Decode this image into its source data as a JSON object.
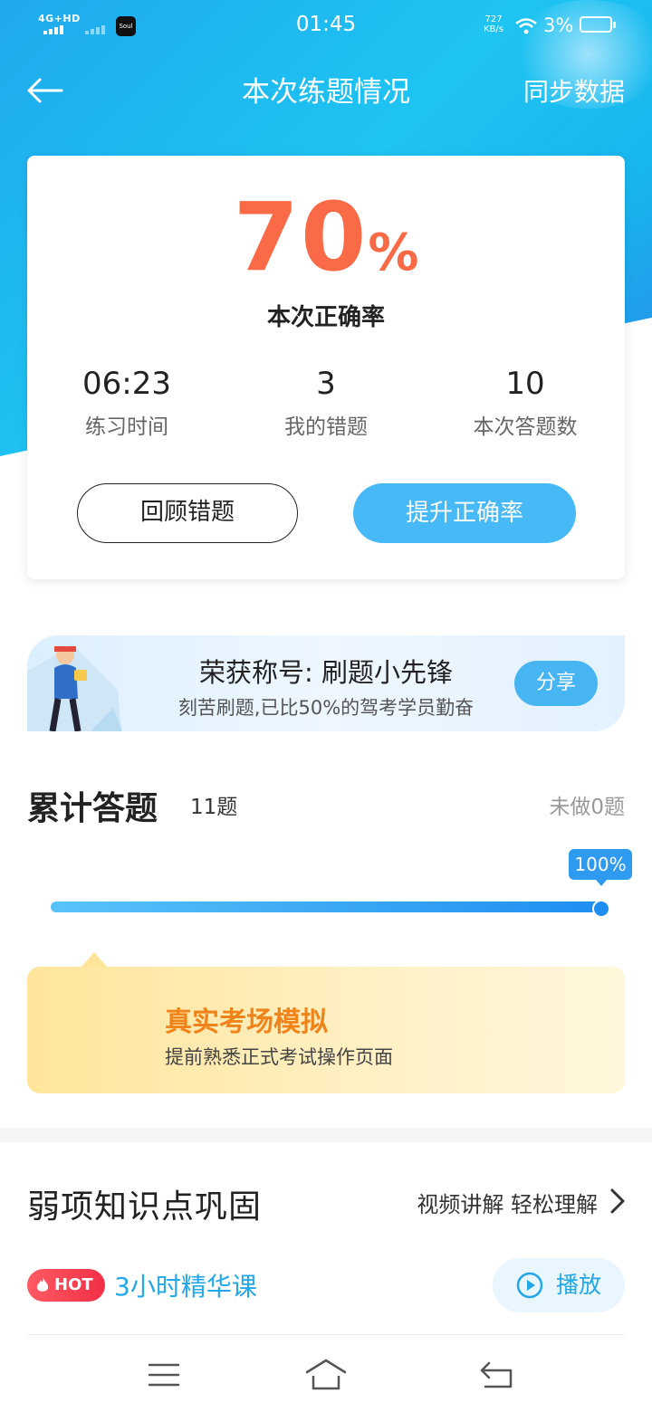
{
  "status_bar": {
    "network": "4G+HD",
    "app_icon_text": "Soul",
    "time": "01:45",
    "speed": "727",
    "speed_unit": "KB/s",
    "battery": "3%"
  },
  "header": {
    "title": "本次练题情况",
    "sync_label": "同步数据"
  },
  "result": {
    "rate_value": "70",
    "rate_unit": "%",
    "rate_label": "本次正确率",
    "time_value": "06:23",
    "time_label": "练习时间",
    "wrong_value": "3",
    "wrong_label": "我的错题",
    "total_value": "10",
    "total_label": "本次答题数",
    "review_label": "回顾错题",
    "improve_label": "提升正确率"
  },
  "honor": {
    "title": "荣获称号: 刷题小先锋",
    "subtitle": "刻苦刷题,已比50%的驾考学员勤奋",
    "share_label": "分享"
  },
  "cumulative": {
    "title": "累计答题",
    "count": "11题",
    "undone": "未做0题",
    "progress_label": "100%",
    "progress": 1.0
  },
  "simulation": {
    "title": "真实考场模拟",
    "subtitle": "提前熟悉正式考试操作页面"
  },
  "weak": {
    "title": "弱项知识点巩固",
    "link_label": "视频讲解 轻松理解",
    "hot_label": "HOT",
    "course_name": "3小时精华课",
    "play_label": "播放"
  },
  "colors": {
    "accent": "#47b9f6",
    "rate": "#fb6a46",
    "hot": "#f02f45",
    "sim_title": "#f08319"
  }
}
